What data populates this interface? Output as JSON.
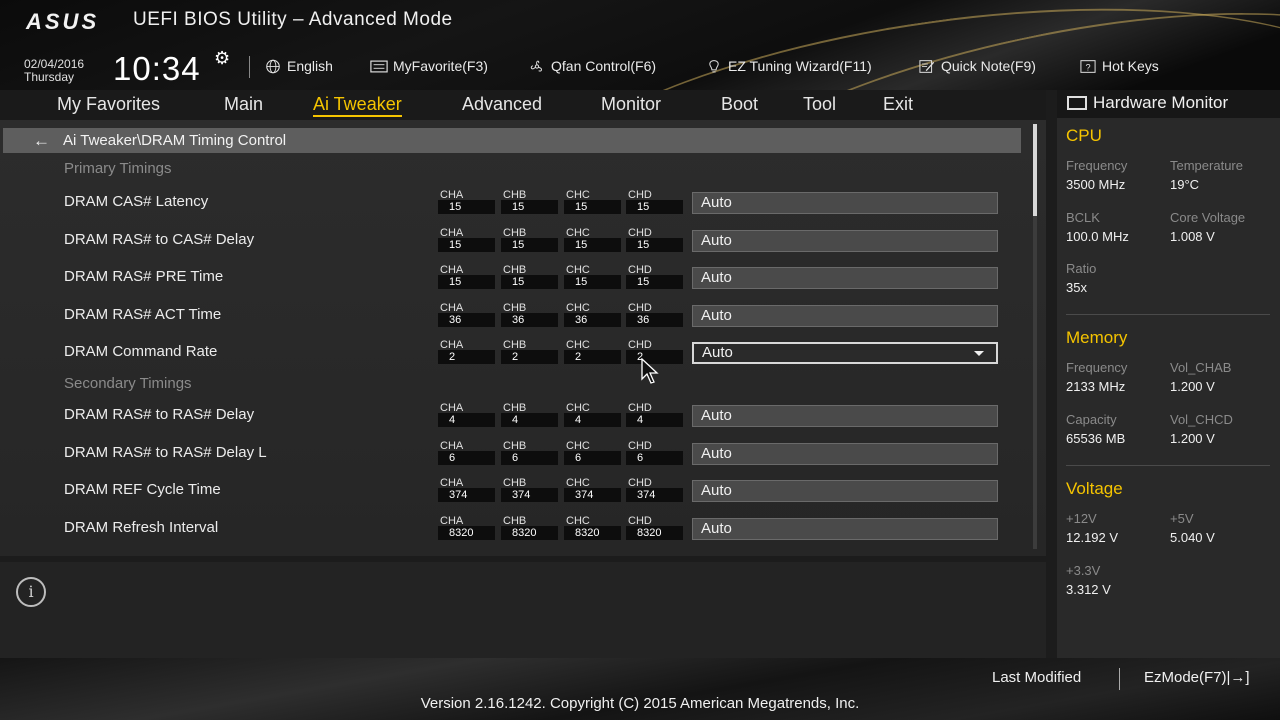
{
  "header": {
    "logo": "ASUS",
    "title": "UEFI BIOS Utility – Advanced Mode",
    "date": "02/04/2016",
    "day": "Thursday",
    "time": "10:34",
    "language": "English",
    "toolbar": {
      "myfavorite": "MyFavorite(F3)",
      "qfan": "Qfan Control(F6)",
      "ez_tuning": "EZ Tuning Wizard(F11)",
      "quick_note": "Quick Note(F9)",
      "hot_keys": "Hot Keys"
    }
  },
  "tabs": [
    "My Favorites",
    "Main",
    "Ai Tweaker",
    "Advanced",
    "Monitor",
    "Boot",
    "Tool",
    "Exit"
  ],
  "active_tab": "Ai Tweaker",
  "breadcrumb": "Ai Tweaker\\DRAM Timing Control",
  "sections": {
    "primary": "Primary Timings",
    "secondary": "Secondary Timings"
  },
  "channel_names": [
    "CHA",
    "CHB",
    "CHC",
    "CHD"
  ],
  "rows": [
    {
      "label": "DRAM CAS# Latency",
      "channels": [
        "15",
        "15",
        "15",
        "15"
      ],
      "value": "Auto"
    },
    {
      "label": "DRAM RAS# to CAS# Delay",
      "channels": [
        "15",
        "15",
        "15",
        "15"
      ],
      "value": "Auto"
    },
    {
      "label": "DRAM RAS# PRE Time",
      "channels": [
        "15",
        "15",
        "15",
        "15"
      ],
      "value": "Auto"
    },
    {
      "label": "DRAM RAS# ACT Time",
      "channels": [
        "36",
        "36",
        "36",
        "36"
      ],
      "value": "Auto"
    },
    {
      "label": "DRAM Command Rate",
      "channels": [
        "2",
        "2",
        "2",
        "2"
      ],
      "value": "Auto"
    },
    {
      "label": "DRAM RAS# to RAS# Delay",
      "channels": [
        "4",
        "4",
        "4",
        "4"
      ],
      "value": "Auto"
    },
    {
      "label": "DRAM RAS# to RAS# Delay L",
      "channels": [
        "6",
        "6",
        "6",
        "6"
      ],
      "value": "Auto"
    },
    {
      "label": "DRAM REF Cycle Time",
      "channels": [
        "374",
        "374",
        "374",
        "374"
      ],
      "value": "Auto"
    },
    {
      "label": "DRAM Refresh Interval",
      "channels": [
        "8320",
        "8320",
        "8320",
        "8320"
      ],
      "value": "Auto"
    }
  ],
  "selected_row_index": 4,
  "hardware_monitor": {
    "title": "Hardware Monitor",
    "cpu": {
      "heading": "CPU",
      "frequency_label": "Frequency",
      "frequency": "3500 MHz",
      "temperature_label": "Temperature",
      "temperature": "19°C",
      "bclk_label": "BCLK",
      "bclk": "100.0 MHz",
      "core_voltage_label": "Core Voltage",
      "core_voltage": "1.008 V",
      "ratio_label": "Ratio",
      "ratio": "35x"
    },
    "memory": {
      "heading": "Memory",
      "frequency_label": "Frequency",
      "frequency": "2133 MHz",
      "vol_chab_label": "Vol_CHAB",
      "vol_chab": "1.200 V",
      "capacity_label": "Capacity",
      "capacity": "65536 MB",
      "vol_chcd_label": "Vol_CHCD",
      "vol_chcd": "1.200 V"
    },
    "voltage": {
      "heading": "Voltage",
      "v12_label": "+12V",
      "v12": "12.192 V",
      "v5_label": "+5V",
      "v5": "5.040 V",
      "v33_label": "+3.3V",
      "v33": "3.312 V"
    }
  },
  "footer": {
    "last_modified": "Last Modified",
    "ezmode": "EzMode(F7)|→]",
    "version": "Version 2.16.1242. Copyright (C) 2015 American Megatrends, Inc."
  },
  "colors": {
    "accent": "#f5c400",
    "background": "#1c1c1c"
  }
}
